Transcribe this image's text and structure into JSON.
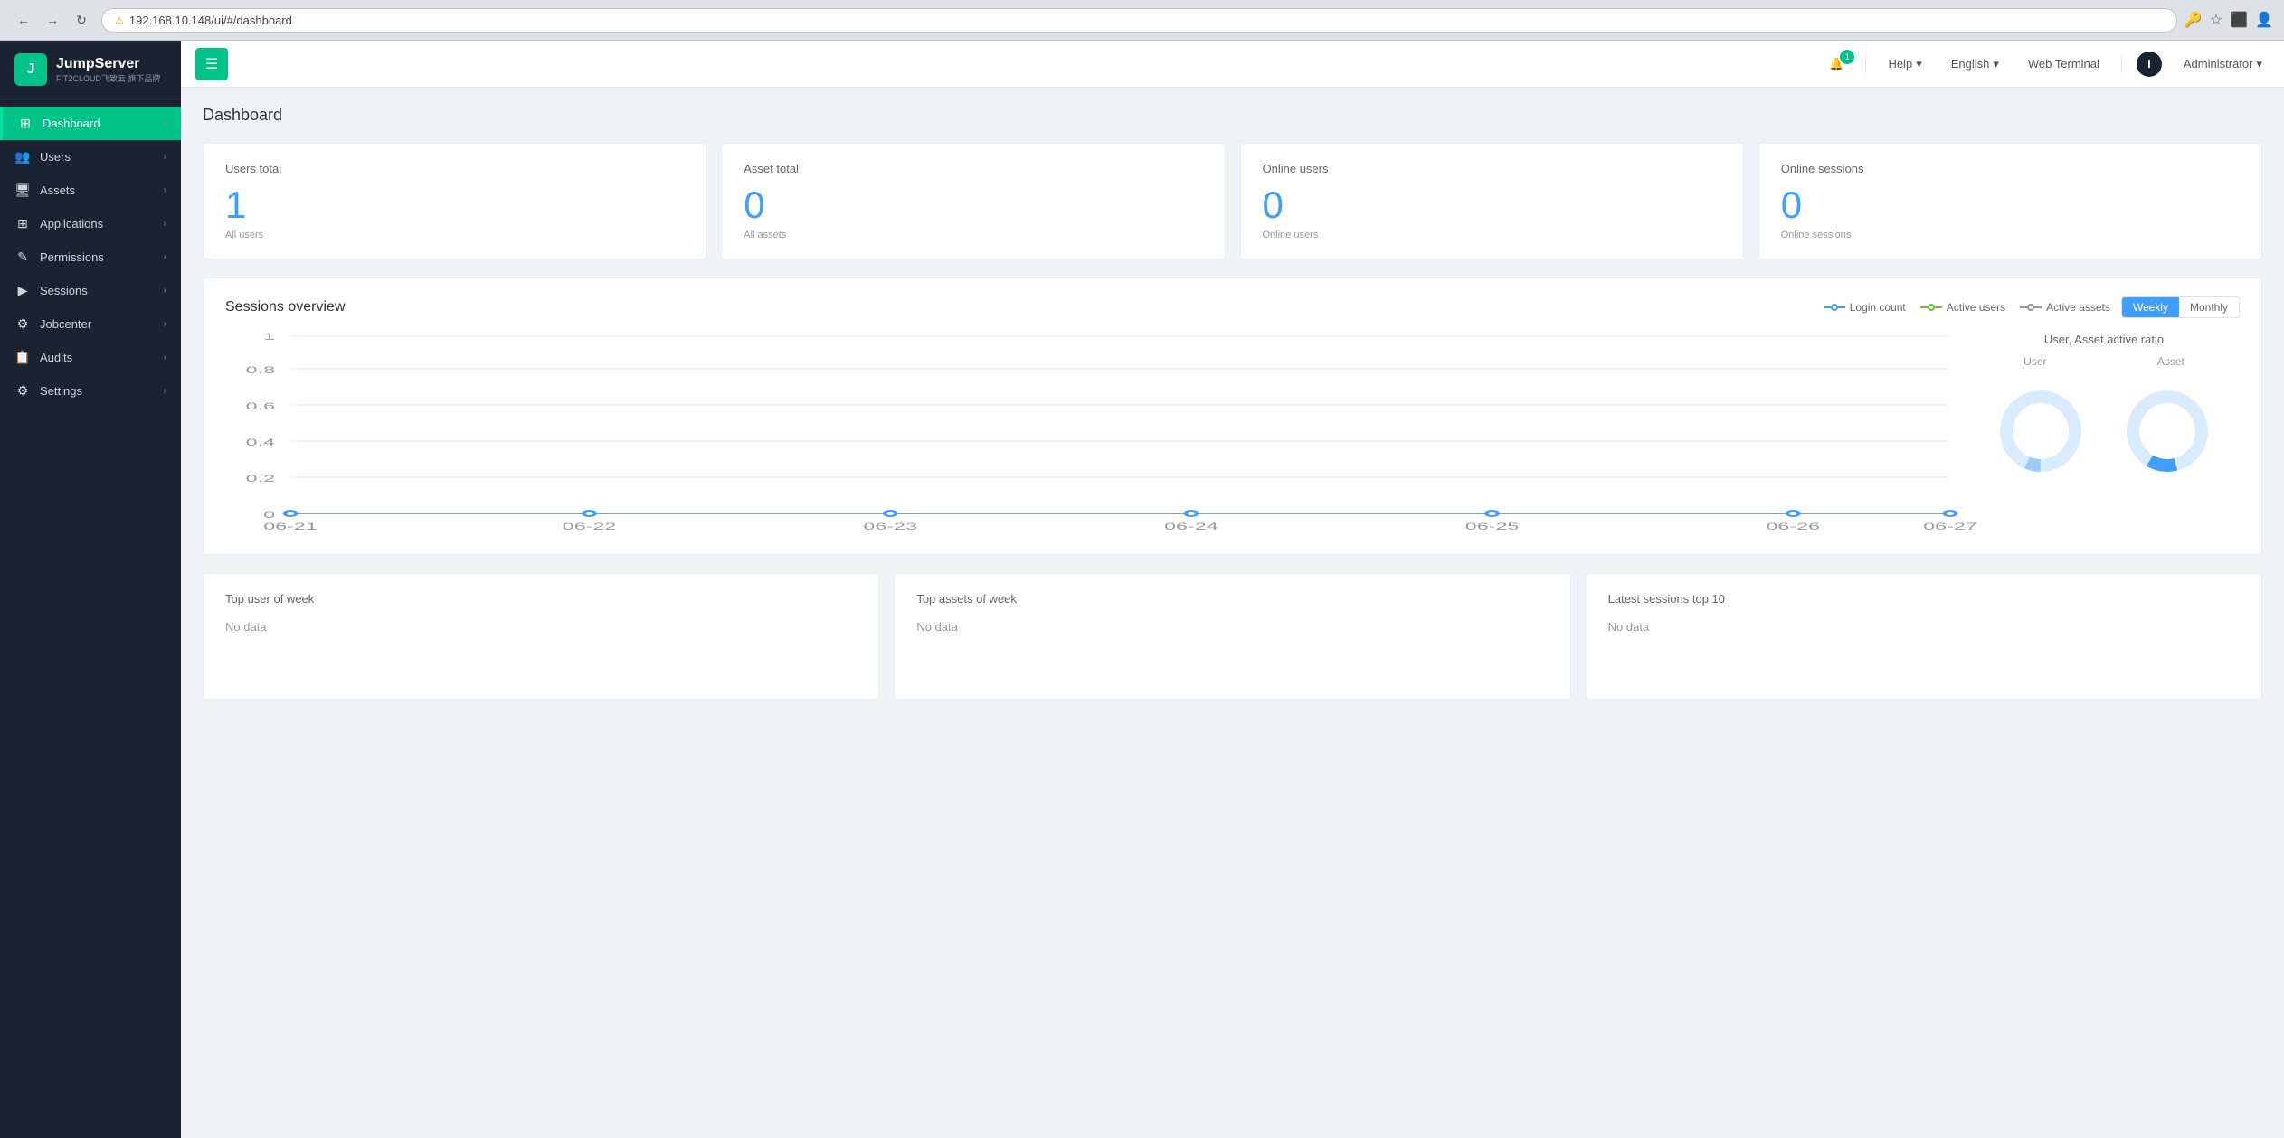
{
  "browser": {
    "url": "192.168.10.148/ui/#/dashboard",
    "warning": "不安全"
  },
  "header": {
    "menu_icon": "☰",
    "bell_count": "1",
    "help_label": "Help",
    "language_label": "English",
    "web_terminal_label": "Web Terminal",
    "user_label": "Administrator"
  },
  "sidebar": {
    "logo_letter": "J",
    "logo_name": "JumpServer",
    "logo_sub": "FIT2CLOUD飞致云 旗下品牌",
    "items": [
      {
        "id": "dashboard",
        "label": "Dashboard",
        "icon": "⊞",
        "active": true
      },
      {
        "id": "users",
        "label": "Users",
        "icon": "👥",
        "active": false
      },
      {
        "id": "assets",
        "label": "Assets",
        "icon": "🖥",
        "active": false
      },
      {
        "id": "applications",
        "label": "Applications",
        "icon": "⊞",
        "active": false
      },
      {
        "id": "permissions",
        "label": "Permissions",
        "icon": "✎",
        "active": false
      },
      {
        "id": "sessions",
        "label": "Sessions",
        "icon": "▶",
        "active": false
      },
      {
        "id": "jobcenter",
        "label": "Jobcenter",
        "icon": "⚙",
        "active": false
      },
      {
        "id": "audits",
        "label": "Audits",
        "icon": "📋",
        "active": false
      },
      {
        "id": "settings",
        "label": "Settings",
        "icon": "⚙",
        "active": false
      }
    ]
  },
  "page": {
    "title": "Dashboard"
  },
  "stats": [
    {
      "id": "users-total",
      "title": "Users total",
      "value": "1",
      "sub": "All users"
    },
    {
      "id": "asset-total",
      "title": "Asset total",
      "value": "0",
      "sub": "All assets"
    },
    {
      "id": "online-users",
      "title": "Online users",
      "value": "0",
      "sub": "Online users"
    },
    {
      "id": "online-sessions",
      "title": "Online sessions",
      "value": "0",
      "sub": "Online sessions"
    }
  ],
  "sessions": {
    "title": "Sessions overview",
    "legend": [
      {
        "label": "Login count",
        "color": "#409eff"
      },
      {
        "label": "Active users",
        "color": "#67c23a"
      },
      {
        "label": "Active assets",
        "color": "#909399"
      }
    ],
    "x_labels": [
      "06-21",
      "06-22",
      "06-23",
      "06-24",
      "06-25",
      "06-26",
      "06-27"
    ],
    "y_labels": [
      "0",
      "0.2",
      "0.4",
      "0.6",
      "0.8",
      "1"
    ],
    "weekly_label": "Weekly",
    "monthly_label": "Monthly",
    "active_button": "weekly"
  },
  "ratio": {
    "title": "User, Asset active ratio",
    "user_label": "User",
    "asset_label": "Asset"
  },
  "bottom": [
    {
      "id": "top-user-week",
      "title": "Top user of week",
      "empty_text": "No data"
    },
    {
      "id": "top-assets-week",
      "title": "Top assets of week",
      "empty_text": "No data"
    },
    {
      "id": "latest-sessions",
      "title": "Latest sessions top 10",
      "empty_text": "No data"
    }
  ]
}
